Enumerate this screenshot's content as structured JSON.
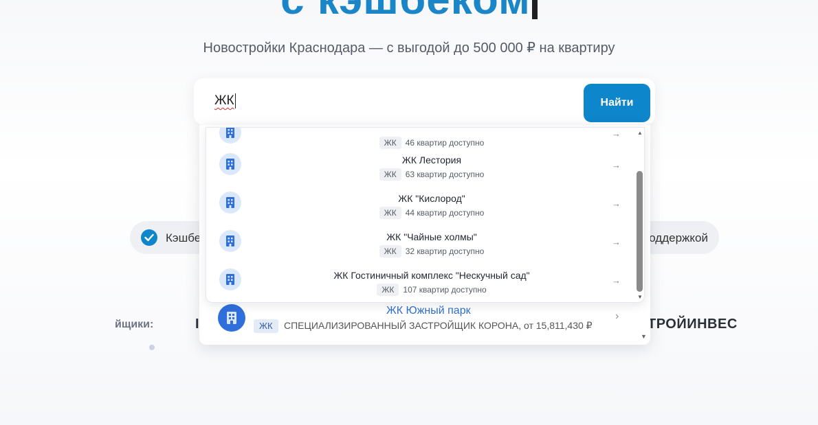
{
  "hero": {
    "title": "с кэшбеком",
    "subtitle": "Новостройки Краснодара — с выгодой до 500 000 ₽ на квартиру"
  },
  "search": {
    "value": "ЖК",
    "button_label": "Найти"
  },
  "features": {
    "left_text": "Кэшбе",
    "right_text": "оддержкой"
  },
  "developers": {
    "label": "йщики:",
    "left_fragment": "I",
    "right_fragment": "ТРОЙИНВЕС"
  },
  "suggestions": {
    "partial_item": {
      "badge": "ЖК",
      "count": "46 квартир доступно"
    },
    "items": [
      {
        "title": "ЖК Лестория",
        "badge": "ЖК",
        "count": "63 квартир доступно"
      },
      {
        "title": "ЖК \"Кислород\"",
        "badge": "ЖК",
        "count": "44 квартир доступно"
      },
      {
        "title": "ЖК \"Чайные холмы\"",
        "badge": "ЖК",
        "count": "32 квартир доступно"
      },
      {
        "title": "ЖК Гостиничный комплекс \"Нескучный сад\"",
        "badge": "ЖК",
        "count": "107 квартир доступно"
      }
    ],
    "arrow_glyph": "→"
  },
  "outer_result": {
    "title": "ЖК Южный парк",
    "badge": "ЖК",
    "meta": "СПЕЦИАЛИЗИРОВАННЫЙ ЗАСТРОЙЩИК КОРОНА, от 15,811,430 ₽",
    "chevron_glyph": "›"
  },
  "colors": {
    "accent": "#0e86cc",
    "link": "#2f6fcf",
    "icon_bg": "#dbe7fb"
  }
}
